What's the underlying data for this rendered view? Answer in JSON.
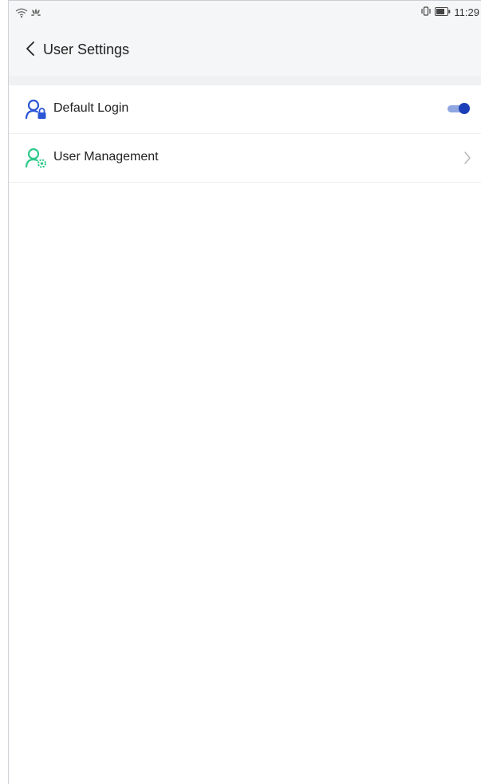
{
  "status_bar": {
    "time": "11:29",
    "icons": [
      "wifi-icon",
      "huawei-icon",
      "vibrate-icon",
      "battery-icon"
    ]
  },
  "header": {
    "title": "User Settings",
    "back_icon": "chevron-left-icon"
  },
  "settings": {
    "items": [
      {
        "label": "Default Login",
        "icon": "user-lock-icon",
        "control": "toggle",
        "enabled": true
      },
      {
        "label": "User Management",
        "icon": "user-gear-icon",
        "control": "chevron-right-icon"
      }
    ]
  },
  "colors": {
    "accent": "#1b3fb8",
    "toggle_track": "#8fa6e0",
    "user_lock_icon": "#2b56d6",
    "user_gear_icon": "#2fc98a",
    "header_background": "#f5f6f7"
  }
}
